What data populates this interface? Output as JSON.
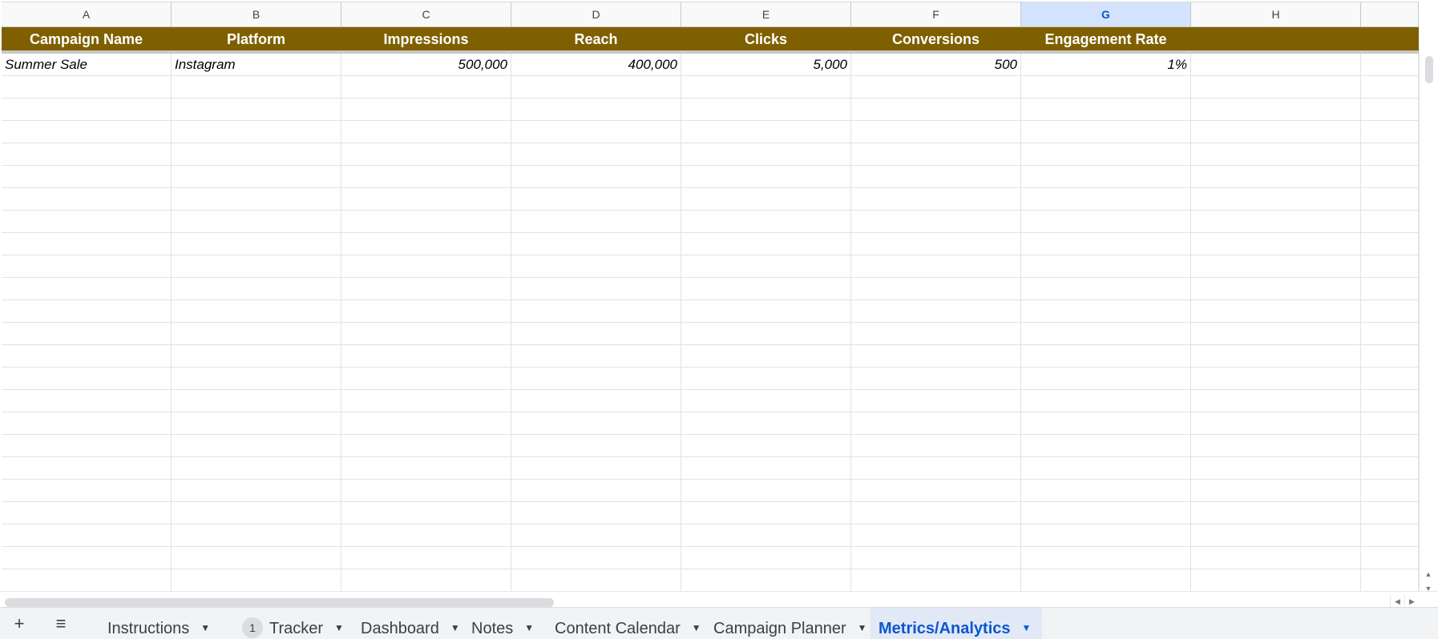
{
  "columns": [
    {
      "letter": "A",
      "header": "Campaign Name"
    },
    {
      "letter": "B",
      "header": "Platform"
    },
    {
      "letter": "C",
      "header": "Impressions"
    },
    {
      "letter": "D",
      "header": "Reach"
    },
    {
      "letter": "E",
      "header": "Clicks"
    },
    {
      "letter": "F",
      "header": "Conversions"
    },
    {
      "letter": "G",
      "header": "Engagement Rate"
    },
    {
      "letter": "H",
      "header": ""
    }
  ],
  "selected_column": "G",
  "rows": [
    [
      "Summer Sale",
      "Instagram",
      "500,000",
      "400,000",
      "5,000",
      "500",
      "1%",
      ""
    ]
  ],
  "tabbar": {
    "add_icon": "plus-icon",
    "menu_icon": "hamburger-menu-icon",
    "tabs": [
      {
        "label": "Instructions",
        "badge": null,
        "active": false
      },
      {
        "label": "Tracker",
        "badge": "1",
        "active": false
      },
      {
        "label": "Dashboard",
        "badge": null,
        "active": false
      },
      {
        "label": "Notes",
        "badge": null,
        "active": false
      },
      {
        "label": "Content Calendar",
        "badge": null,
        "active": false
      },
      {
        "label": "Campaign Planner",
        "badge": null,
        "active": false
      },
      {
        "label": "Metrics/Analytics",
        "badge": null,
        "active": true
      }
    ]
  },
  "colors": {
    "header_fill": "#7f6000",
    "header_text": "#ffffff",
    "active_tab_text": "#0b57d0",
    "active_tab_fill": "#e1e9f7",
    "selected_column_fill": "#d3e3fd"
  }
}
